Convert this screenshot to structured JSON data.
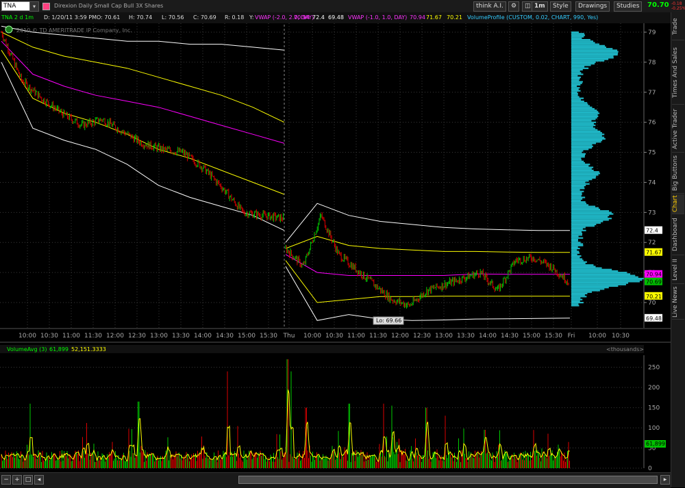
{
  "toolbar": {
    "symbol": "TNA",
    "title": "Direxion Daily Small Cap Bull 3X Shares",
    "think_ai": "think A.I.",
    "timeframe": "1m",
    "style": "Style",
    "drawings": "Drawings",
    "studies": "Studies",
    "last_price": "70.70",
    "change1": "-0.18",
    "change2": "-0.25%"
  },
  "info": {
    "aggregation": "TNA 2 d 1m",
    "date": "D: 1/20/11 3:59 PM",
    "open": "O: 70.61",
    "high": "H: 70.74",
    "low": "L: 70.56",
    "close": "C: 70.69",
    "range": "R: 0.18",
    "y": "Y:",
    "vwap1": "VWAP (-2.0, 2.0, DAY)",
    "vwap1_v1": "70.94",
    "vwap1_v2": "72.4",
    "vwap1_v3": "69.48",
    "vwap2": "VWAP (-1.0, 1.0, DAY)",
    "vwap2_v1": "70.94",
    "vwap2_v2": "71.67",
    "vwap2_v3": "70.21",
    "vp": "VolumeProfile (CUSTOM, 0.02, CHART, 990, Yes)"
  },
  "copyright": "2010 © TD AMERITRADE IP Company, Inc.",
  "price_axis": {
    "ticks": [
      "79",
      "78",
      "77",
      "76",
      "75",
      "74",
      "73",
      "72",
      "71",
      "70"
    ],
    "markers": [
      {
        "label": "72.4",
        "value": 72.4,
        "bg": "#ffffff",
        "fg": "#000000"
      },
      {
        "label": "71.67",
        "value": 71.67,
        "bg": "#ffff00",
        "fg": "#000000"
      },
      {
        "label": "70.94",
        "value": 70.94,
        "bg": "#ff00ff",
        "fg": "#000000"
      },
      {
        "label": "70.69",
        "value": 70.69,
        "bg": "#00c000",
        "fg": "#000000"
      },
      {
        "label": "70.21",
        "value": 70.21,
        "bg": "#ffff00",
        "fg": "#000000"
      },
      {
        "label": "69.48",
        "value": 69.48,
        "bg": "#ffffff",
        "fg": "#000000"
      }
    ]
  },
  "low_label": "Lo: 69.66",
  "time_axis": [
    "10:00",
    "10:30",
    "11:00",
    "11:30",
    "12:00",
    "12:30",
    "13:00",
    "13:30",
    "14:00",
    "14:30",
    "15:00",
    "15:30",
    "Thu",
    "10:00",
    "10:30",
    "11:00",
    "11:30",
    "12:00",
    "12:30",
    "13:00",
    "13:30",
    "14:00",
    "14:30",
    "15:00",
    "15:30",
    "Fri",
    "10:00",
    "10:30"
  ],
  "volume": {
    "title": "VolumeAvg (3)",
    "value1": "61,899",
    "value2": "52,151.3333",
    "unit": "<thousands>",
    "ticks": [
      "250",
      "200",
      "150",
      "100",
      "50",
      "0"
    ],
    "marker": "61,899"
  },
  "side_tabs": [
    "Trade",
    "Times And Sales",
    "Active Trader",
    "Big Buttons",
    "Chart",
    "Dashboard",
    "Level II",
    "Live News"
  ],
  "colors": {
    "up": "#00cc00",
    "down": "#dd0000",
    "vwap": "#ff00ff",
    "band1": "#ffff00",
    "band2": "#ffffff",
    "profile": "#1fb5c4",
    "grid": "#3a3a3a"
  },
  "chart_data": {
    "type": "line",
    "price_range": [
      69.3,
      79.2
    ],
    "volume_range": [
      0,
      280
    ],
    "sessions": [
      {
        "vwap": [
          78.7,
          77.6,
          77.2,
          76.9,
          76.7,
          76.5,
          76.2,
          75.9,
          75.6,
          75.3
        ],
        "upper1": [
          79.0,
          78.5,
          78.2,
          78.0,
          77.8,
          77.5,
          77.2,
          76.9,
          76.5,
          76.0
        ],
        "lower1": [
          78.4,
          76.8,
          76.3,
          76.0,
          75.6,
          75.1,
          74.8,
          74.4,
          74.0,
          73.6
        ],
        "upper2": [
          79.2,
          79.0,
          78.9,
          78.8,
          78.7,
          78.7,
          78.6,
          78.6,
          78.5,
          78.4
        ],
        "lower2": [
          78.0,
          75.8,
          75.4,
          75.1,
          74.6,
          73.9,
          73.5,
          73.2,
          72.9,
          72.4
        ],
        "price": [
          79.0,
          77.4,
          76.8,
          76.3,
          75.9,
          76.1,
          75.7,
          75.3,
          75.1,
          75.0,
          74.5,
          73.8,
          73.0,
          72.9,
          72.8
        ]
      },
      {
        "vwap": [
          71.6,
          71.0,
          70.9,
          70.9,
          70.9,
          70.9,
          70.95,
          70.94,
          70.94,
          70.94
        ],
        "upper1": [
          71.8,
          72.2,
          71.9,
          71.8,
          71.75,
          71.7,
          71.7,
          71.68,
          71.67,
          71.67
        ],
        "lower1": [
          71.4,
          70.0,
          70.1,
          70.2,
          70.2,
          70.21,
          70.21,
          70.21,
          70.21,
          70.21
        ],
        "upper2": [
          72.0,
          73.3,
          72.9,
          72.7,
          72.6,
          72.5,
          72.45,
          72.42,
          72.4,
          72.4
        ],
        "lower2": [
          71.2,
          69.4,
          69.6,
          69.45,
          69.4,
          69.42,
          69.45,
          69.46,
          69.47,
          69.48
        ],
        "price": [
          71.8,
          71.2,
          72.9,
          71.6,
          71.1,
          70.6,
          70.1,
          69.9,
          70.4,
          70.6,
          70.8,
          71.0,
          70.4,
          71.4,
          71.5,
          71.2,
          70.7
        ]
      }
    ]
  }
}
